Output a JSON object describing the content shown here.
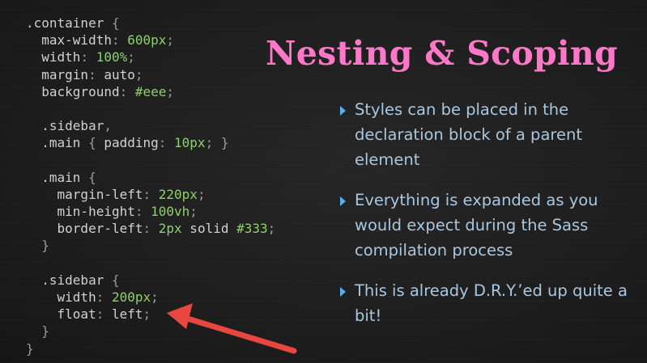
{
  "slide": {
    "title": "Nesting & Scoping",
    "colors": {
      "background": "#1e1e1e",
      "title": "#ff78c8",
      "bullet_text": "#a9c7df",
      "bullet_marker": "#5aaee8",
      "code_text": "#c9c9c9",
      "code_number": "#8ed16c",
      "annotation_arrow": "#e8473f"
    }
  },
  "code": {
    "language": "scss",
    "lines": [
      [
        {
          "t": "sel",
          "v": ".container "
        },
        {
          "t": "punct",
          "v": "{"
        }
      ],
      [
        {
          "t": "prop",
          "v": "  max-width"
        },
        {
          "t": "punct",
          "v": ": "
        },
        {
          "t": "num",
          "v": "600px"
        },
        {
          "t": "punct",
          "v": ";"
        }
      ],
      [
        {
          "t": "prop",
          "v": "  width"
        },
        {
          "t": "punct",
          "v": ": "
        },
        {
          "t": "num",
          "v": "100%"
        },
        {
          "t": "punct",
          "v": ";"
        }
      ],
      [
        {
          "t": "prop",
          "v": "  margin"
        },
        {
          "t": "punct",
          "v": ": "
        },
        {
          "t": "val",
          "v": "auto"
        },
        {
          "t": "punct",
          "v": ";"
        }
      ],
      [
        {
          "t": "prop",
          "v": "  background"
        },
        {
          "t": "punct",
          "v": ": "
        },
        {
          "t": "hex",
          "v": "#eee"
        },
        {
          "t": "punct",
          "v": ";"
        }
      ],
      [],
      [
        {
          "t": "sel",
          "v": "  .sidebar"
        },
        {
          "t": "punct",
          "v": ","
        }
      ],
      [
        {
          "t": "sel",
          "v": "  .main "
        },
        {
          "t": "punct",
          "v": "{ "
        },
        {
          "t": "prop",
          "v": "padding"
        },
        {
          "t": "punct",
          "v": ": "
        },
        {
          "t": "num",
          "v": "10px"
        },
        {
          "t": "punct",
          "v": "; }"
        }
      ],
      [],
      [
        {
          "t": "sel",
          "v": "  .main "
        },
        {
          "t": "punct",
          "v": "{"
        }
      ],
      [
        {
          "t": "prop",
          "v": "    margin-left"
        },
        {
          "t": "punct",
          "v": ": "
        },
        {
          "t": "num",
          "v": "220px"
        },
        {
          "t": "punct",
          "v": ";"
        }
      ],
      [
        {
          "t": "prop",
          "v": "    min-height"
        },
        {
          "t": "punct",
          "v": ": "
        },
        {
          "t": "num",
          "v": "100vh"
        },
        {
          "t": "punct",
          "v": ";"
        }
      ],
      [
        {
          "t": "prop",
          "v": "    border-left"
        },
        {
          "t": "punct",
          "v": ": "
        },
        {
          "t": "num",
          "v": "2px"
        },
        {
          "t": "val",
          "v": " solid "
        },
        {
          "t": "hex",
          "v": "#333"
        },
        {
          "t": "punct",
          "v": ";"
        }
      ],
      [
        {
          "t": "punct",
          "v": "  }"
        }
      ],
      [],
      [
        {
          "t": "sel",
          "v": "  .sidebar "
        },
        {
          "t": "punct",
          "v": "{"
        }
      ],
      [
        {
          "t": "prop",
          "v": "    width"
        },
        {
          "t": "punct",
          "v": ": "
        },
        {
          "t": "num",
          "v": "200px"
        },
        {
          "t": "punct",
          "v": ";"
        }
      ],
      [
        {
          "t": "prop",
          "v": "    float"
        },
        {
          "t": "punct",
          "v": ": "
        },
        {
          "t": "val",
          "v": "left"
        },
        {
          "t": "punct",
          "v": ";"
        }
      ],
      [
        {
          "t": "punct",
          "v": "  }"
        }
      ],
      [
        {
          "t": "punct",
          "v": "}"
        }
      ]
    ]
  },
  "bullets": [
    {
      "text": "Styles can be placed in the declaration block of a parent element"
    },
    {
      "text": "Everything is expanded as you would expect during the Sass compilation process"
    },
    {
      "text": "This is already D.R.Y.’ed up quite a bit!"
    }
  ],
  "annotation": {
    "type": "arrow",
    "points_to": "float: left;"
  }
}
